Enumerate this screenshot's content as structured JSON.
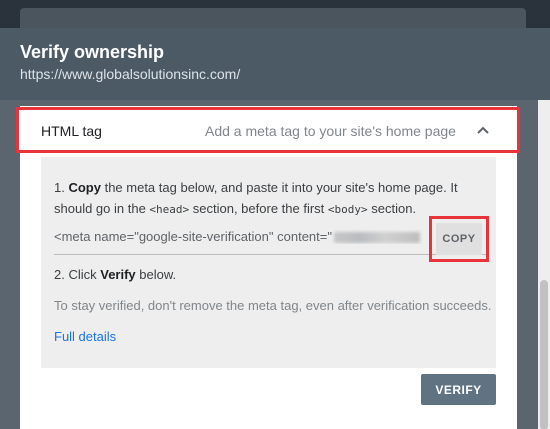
{
  "dialog": {
    "title": "Verify ownership",
    "url": "https://www.globalsolutionsinc.com/"
  },
  "method": {
    "title": "HTML tag",
    "description": "Add a meta tag to your site's home page",
    "chevron_icon": "chevron-up-icon"
  },
  "instructions": {
    "step1_prefix": "1. ",
    "step1_bold": "Copy",
    "step1_text": " the meta tag below, and paste it into your site's home page. It should go in the ",
    "head_tag": "<head>",
    "step1_text2": " section, before the first ",
    "body_tag": "<body>",
    "step1_text3": " section.",
    "meta_tag_value": "<meta name=\"google-site-verification\" content=\"",
    "copy_label": "COPY",
    "step2_prefix": "2. Click ",
    "step2_bold": "Verify",
    "step2_suffix": " below.",
    "note": "To stay verified, don't remove the meta tag, even after verification succeeds.",
    "full_details_link": "Full details"
  },
  "actions": {
    "verify_label": "VERIFY"
  },
  "colors": {
    "highlight": "#e8333b",
    "link": "#1a73e8",
    "header_bg": "#4c5a66",
    "verify_bg": "#5f7382"
  }
}
